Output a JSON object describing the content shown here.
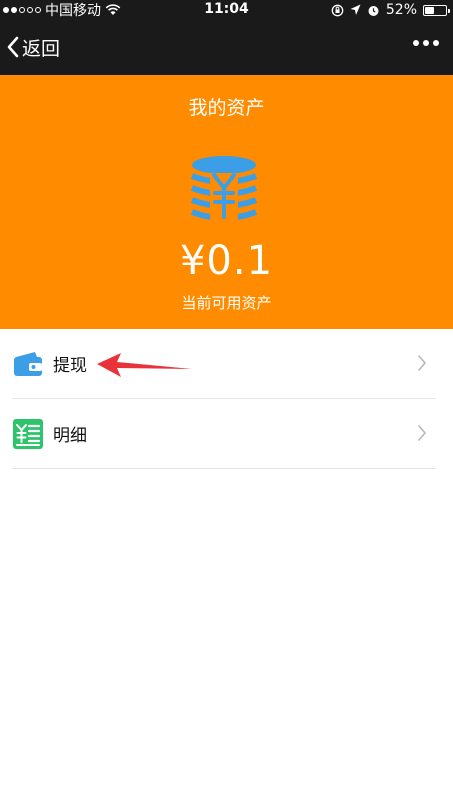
{
  "status_bar": {
    "carrier": "中国移动",
    "time": "11:04",
    "battery_percent": "52%",
    "battery_level": 0.52,
    "icons": [
      "signal-dots-icon",
      "wifi-icon",
      "orientation-lock-icon",
      "location-arrow-icon",
      "alarm-icon",
      "battery-icon"
    ]
  },
  "nav": {
    "back_label": "返回",
    "more_icon": "more-dots-icon"
  },
  "header": {
    "title": "我的资产",
    "balance": "¥0.1",
    "balance_label": "当前可用资产",
    "icon": "yuan-coin-stack-icon"
  },
  "menu": {
    "items": [
      {
        "label": "提现",
        "icon": "wallet-icon"
      },
      {
        "label": "明细",
        "icon": "details-list-icon"
      }
    ]
  },
  "colors": {
    "status_bar_bg": "#1a1a1a",
    "header_bg": "#ff8c00",
    "coin_blue": "#3d9ee8",
    "wallet_blue": "#3d9ee8",
    "details_green": "#2dc46b",
    "annotation_red": "#e8333a",
    "chevron_gray": "#b8b8b8"
  }
}
